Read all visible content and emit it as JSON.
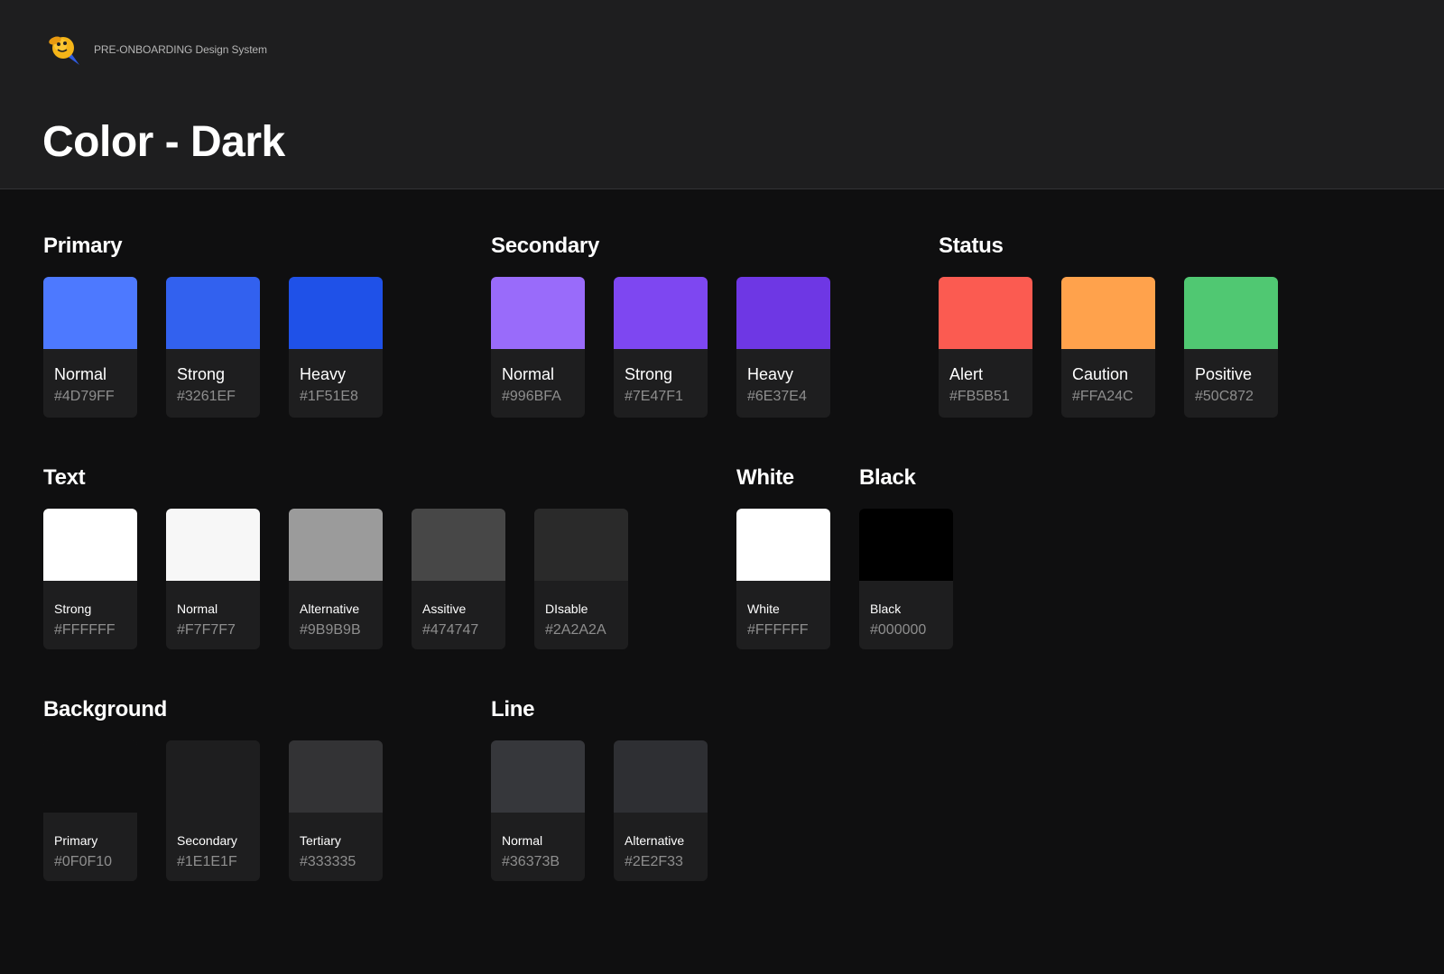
{
  "header": {
    "brand": "PRE-ONBOARDING Design System",
    "title": "Color - Dark"
  },
  "sections": {
    "primary": {
      "title": "Primary",
      "items": [
        {
          "name": "Normal",
          "hex": "#4D79FF",
          "color": "#4D79FF"
        },
        {
          "name": "Strong",
          "hex": "#3261EF",
          "color": "#3261EF"
        },
        {
          "name": "Heavy",
          "hex": "#1F51E8",
          "color": "#1F51E8"
        }
      ]
    },
    "secondary": {
      "title": "Secondary",
      "items": [
        {
          "name": "Normal",
          "hex": "#996BFA",
          "color": "#996BFA"
        },
        {
          "name": "Strong",
          "hex": "#7E47F1",
          "color": "#7E47F1"
        },
        {
          "name": "Heavy",
          "hex": "#6E37E4",
          "color": "#6E37E4"
        }
      ]
    },
    "status": {
      "title": "Status",
      "items": [
        {
          "name": "Alert",
          "hex": "#FB5B51",
          "color": "#FB5B51"
        },
        {
          "name": "Caution",
          "hex": "#FFA24C",
          "color": "#FFA24C"
        },
        {
          "name": "Positive",
          "hex": "#50C872",
          "color": "#50C872"
        }
      ]
    },
    "text": {
      "title": "Text",
      "items": [
        {
          "name": "Strong",
          "hex": "#FFFFFF",
          "color": "#FFFFFF"
        },
        {
          "name": "Normal",
          "hex": "#F7F7F7",
          "color": "#F7F7F7"
        },
        {
          "name": "Alternative",
          "hex": "#9B9B9B",
          "color": "#9B9B9B"
        },
        {
          "name": "Assitive",
          "hex": "#474747",
          "color": "#474747"
        },
        {
          "name": "DIsable",
          "hex": "#2A2A2A",
          "color": "#2A2A2A"
        }
      ]
    },
    "white": {
      "title": "White",
      "items": [
        {
          "name": "White",
          "hex": "#FFFFFF",
          "color": "#FFFFFF"
        }
      ]
    },
    "black": {
      "title": "Black",
      "items": [
        {
          "name": "Black",
          "hex": "#000000",
          "color": "#000000"
        }
      ]
    },
    "background": {
      "title": "Background",
      "items": [
        {
          "name": "Primary",
          "hex": "#0F0F10",
          "color": "#0F0F10"
        },
        {
          "name": "Secondary",
          "hex": "#1E1E1F",
          "color": "#1E1E1F"
        },
        {
          "name": "Tertiary",
          "hex": "#333335",
          "color": "#333335"
        }
      ]
    },
    "line": {
      "title": "Line",
      "items": [
        {
          "name": "Normal",
          "hex": "#36373B",
          "color": "#36373B"
        },
        {
          "name": "Alternative",
          "hex": "#2E2F33",
          "color": "#2E2F33"
        }
      ]
    }
  }
}
